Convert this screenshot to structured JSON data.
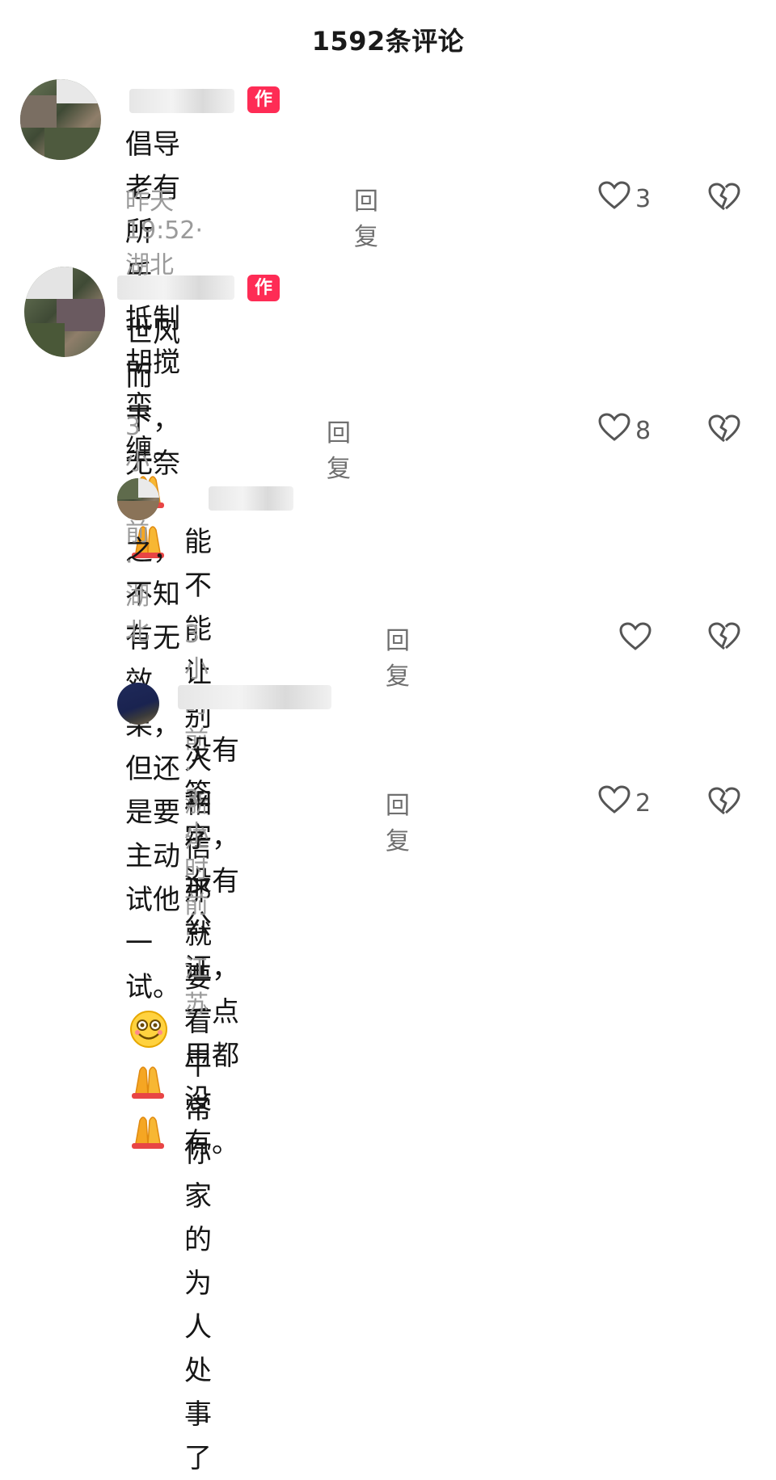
{
  "header": {
    "title": "1592条评论"
  },
  "comments": [
    {
      "username": "",
      "badge": "作者",
      "text": "倡导老有所乐，抵制胡搅蛮缠。",
      "emojis": [
        "folded-hands",
        "folded-hands"
      ],
      "meta": "昨天19:52·湖北",
      "reply": "回复",
      "likes": "3"
    },
    {
      "username": "",
      "badge": "作者",
      "text": "世风而下，无奈为之，不知有无效果，但还是要主动试他一试。",
      "text_line1": "世风而下，无奈为之，不知有无效果，但还",
      "text_line2": "是要主动试他一试。",
      "emojis": [
        "smiley",
        "folded-hands",
        "folded-hands"
      ],
      "meta": "3小时前·湖北",
      "reply": "回复",
      "likes": "8"
    },
    {
      "username": "",
      "text": "能不能让别人相信那就要看平常你家的为人处事了",
      "text_line1": "能不能让别人相信那就要看平常你家的",
      "text_line2": "为人处事了",
      "meta": "3小时前·浙江",
      "reply": "回复",
      "likes": ""
    },
    {
      "username": "",
      "text": "没有签字，没有公证，一点用都没有。",
      "meta": "3小时前·江苏",
      "reply": "回复",
      "likes": "2"
    }
  ],
  "colors": {
    "badge": "#fe2c55",
    "meta": "#9a9a9a",
    "text": "#161616"
  }
}
